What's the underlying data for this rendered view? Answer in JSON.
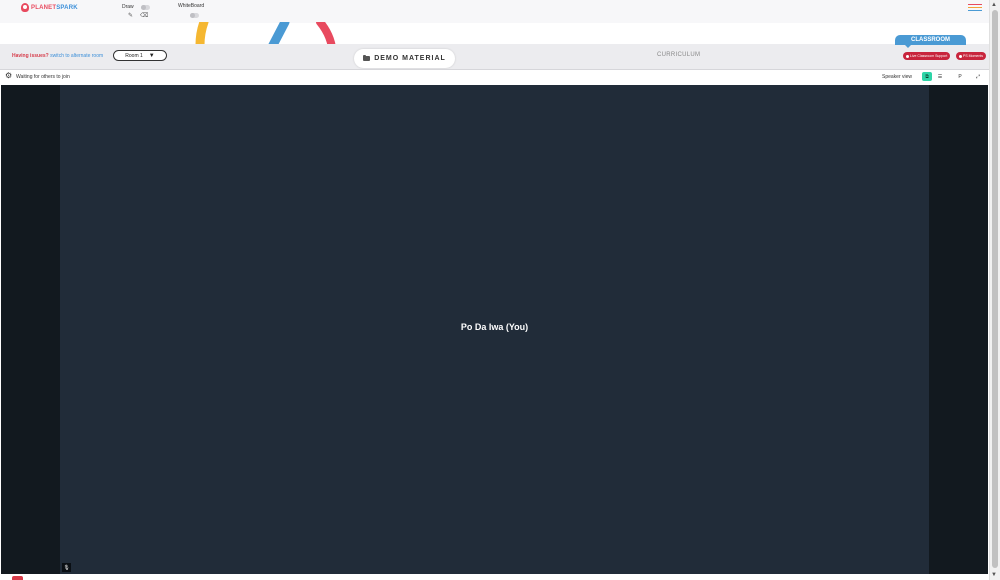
{
  "app": {
    "logo": {
      "part1": "PLANET",
      "part2": "SPARK"
    }
  },
  "toolbar": {
    "draw_label": "Draw",
    "whiteboard_label": "WhiteBoard"
  },
  "room_bar": {
    "issues_label": "Having issues?",
    "switch_link": "switch to alternate room",
    "room_select": {
      "value": "Room 1",
      "caret": "▼"
    },
    "demo_material": "DEMO MATERIAL",
    "curriculum_tab": "CURRICULUM",
    "classroom_tab": "CLASSROOM",
    "live_support": "Live Classroom Support",
    "ps_moments": "PS Moments"
  },
  "meeting": {
    "status": "Waiting for others to join",
    "view_mode": "Speaker view",
    "view_buttons": [
      "⧉",
      "☰",
      "P",
      "⤢"
    ],
    "participant_name": "Po Da Iwa (You)"
  },
  "colors": {
    "accent_red": "#d63c4a",
    "accent_blue": "#4a9ad4",
    "active_green": "#2dd4a7",
    "video_bg": "#212c39",
    "video_outer_bg": "#12191f"
  },
  "icons": {
    "gear": "gear-icon",
    "pencil": "pencil-icon",
    "eraser": "eraser-icon",
    "folder": "folder-icon",
    "mic": "microphone-icon",
    "hamburger": "hamburger-menu-icon"
  }
}
